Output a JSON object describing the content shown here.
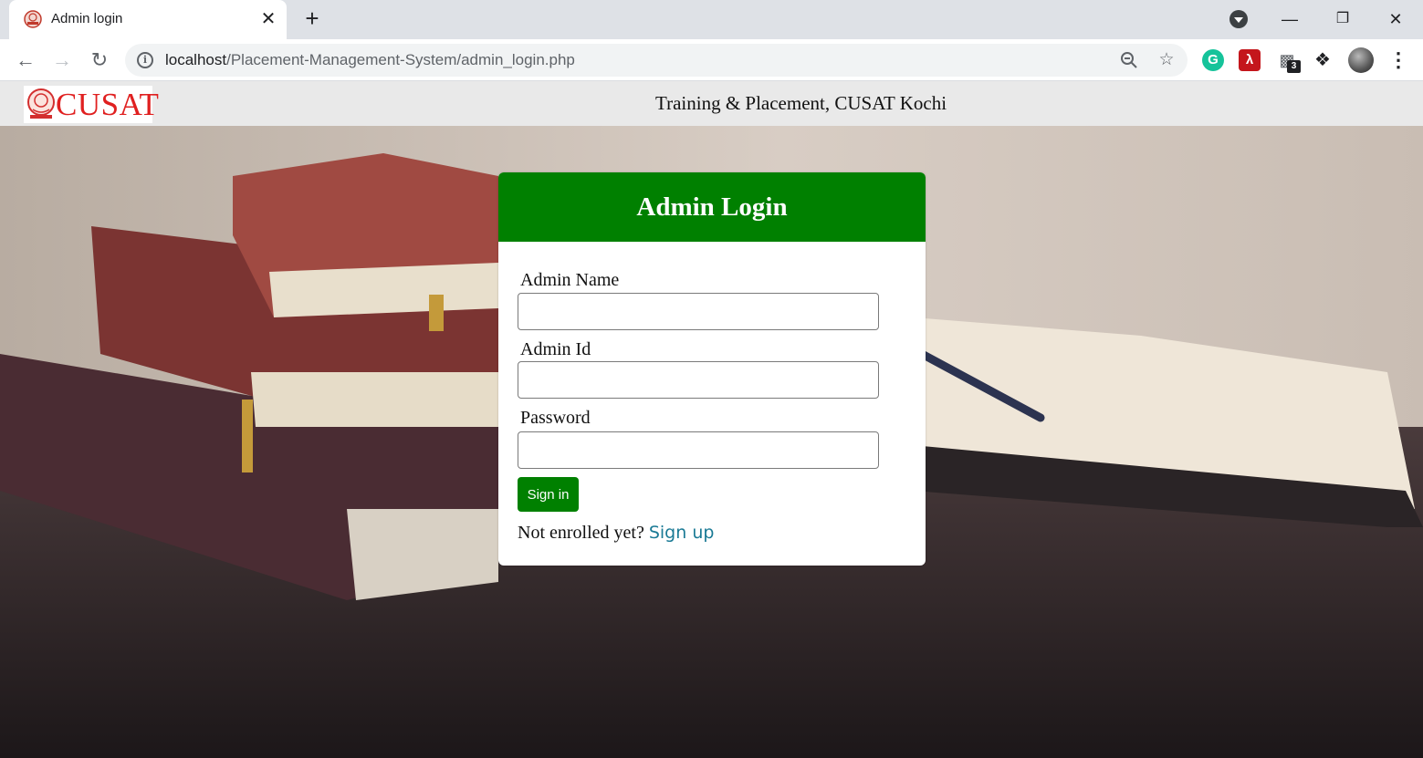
{
  "browser": {
    "tab_title": "Admin login",
    "tab_close": "✕",
    "new_tab": "+",
    "url_host": "localhost",
    "url_path": "/Placement-Management-System/admin_login.php",
    "extension_badge": "3",
    "window_controls": {
      "minimize": "—",
      "restore": "❐",
      "close": "✕"
    },
    "icons": [
      "back-arrow-icon",
      "forward-arrow-icon",
      "reload-icon",
      "info-icon",
      "zoom-icon",
      "star-icon",
      "grammarly-icon",
      "acrobat-pdf-icon",
      "clipboard-extension-icon",
      "puzzle-extensions-icon",
      "profile-avatar",
      "menu-dots-icon"
    ]
  },
  "header": {
    "logo_text": "CUSAT",
    "site_title": "Training & Placement, CUSAT Kochi"
  },
  "login": {
    "heading": "Admin Login",
    "name_label": "Admin Name",
    "name_value": "",
    "id_label": "Admin Id",
    "id_value": "",
    "password_label": "Password",
    "password_value": "",
    "submit_label": "Sign in",
    "enroll_prompt": "Not enrolled yet?",
    "signup_link": "Sign up"
  },
  "colors": {
    "brand_green": "#008000",
    "logo_red": "#e02020",
    "link_blue": "#1a7a95",
    "header_bg": "#e9e9e9"
  }
}
